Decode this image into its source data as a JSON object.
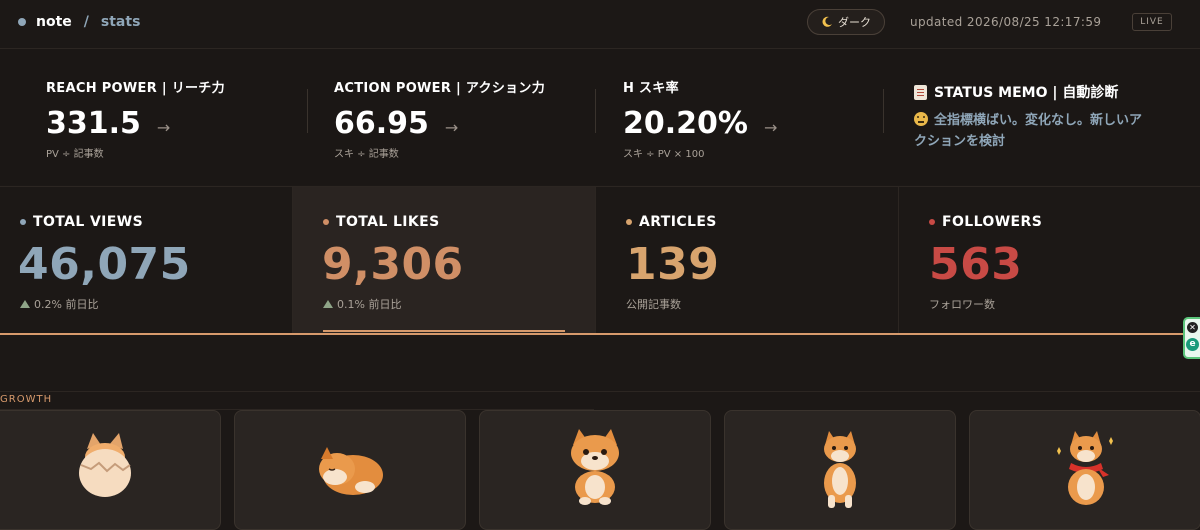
{
  "header": {
    "brand": "note",
    "separator": "/",
    "page": "stats",
    "theme_button": "ダーク",
    "updated": "updated 2026/08/25 12:17:59",
    "live_badge": "LIVE"
  },
  "power": [
    {
      "label": "REACH POWER | リーチ力",
      "value": "331.5",
      "arrow": "→",
      "formula": "PV ÷ 記事数"
    },
    {
      "label": "ACTION POWER | アクション力",
      "value": "66.95",
      "arrow": "→",
      "formula": "スキ ÷ 記事数"
    },
    {
      "label": "H スキ率",
      "value": "20.20%",
      "arrow": "→",
      "formula": "スキ ÷ PV × 100"
    }
  ],
  "memo": {
    "title": "STATUS MEMO | 自動診断",
    "text": "全指標横ばい。変化なし。新しいアクションを検討"
  },
  "stats": [
    {
      "label": "TOTAL VIEWS",
      "value": "46,075",
      "sub": "0.2% 前日比",
      "trend": "up",
      "color": "#8fa6b8"
    },
    {
      "label": "TOTAL LIKES",
      "value": "9,306",
      "sub": "0.1% 前日比",
      "trend": "up",
      "color": "#d08f66"
    },
    {
      "label": "ARTICLES",
      "value": "139",
      "sub": "公開記事数",
      "trend": "none",
      "color": "#d8a46e"
    },
    {
      "label": "FOLLOWERS",
      "value": "563",
      "sub": "フォロワー数",
      "trend": "none",
      "color": "#c84a45"
    }
  ],
  "growth": {
    "label": "GROWTH",
    "stages": [
      "egg-dog-icon",
      "sleeping-puppy-icon",
      "sitting-puppy-icon",
      "standing-shiba-icon",
      "scarf-shiba-icon"
    ]
  },
  "colors": {
    "accent": "#d79a6c",
    "background": "#1c1816",
    "positive": "#8fa588"
  }
}
